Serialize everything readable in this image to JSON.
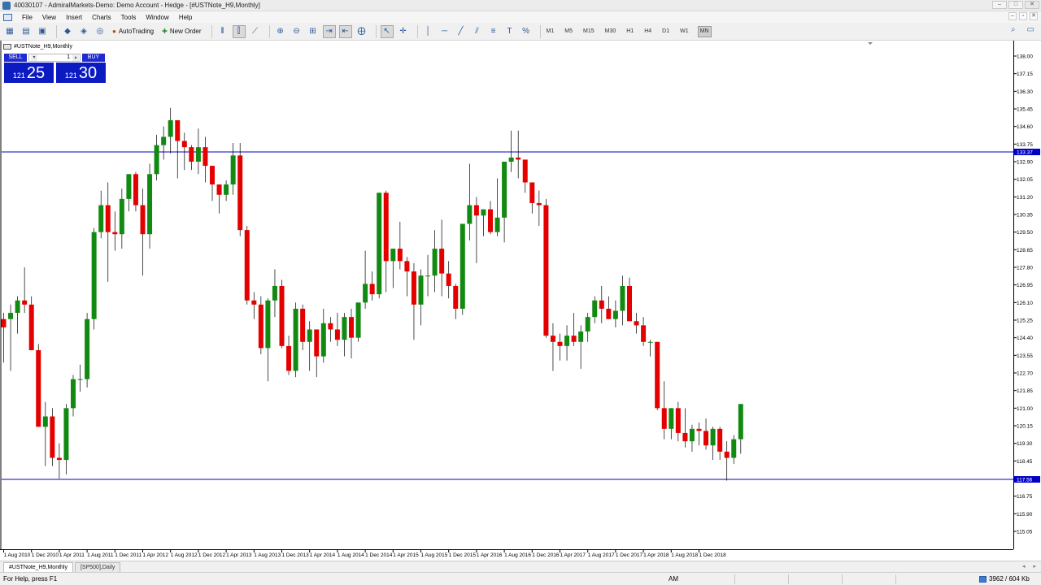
{
  "window": {
    "title": "40030107 - AdmiralMarkets-Demo: Demo Account - Hedge - [#USTNote_H9,Monthly]"
  },
  "menu": [
    "File",
    "View",
    "Insert",
    "Charts",
    "Tools",
    "Window",
    "Help"
  ],
  "toolbar": {
    "autotrading": "AutoTrading",
    "new_order": "New Order",
    "timeframes": [
      "M1",
      "M5",
      "M15",
      "M30",
      "H1",
      "H4",
      "D1",
      "W1",
      "MN"
    ],
    "active_timeframe": "MN"
  },
  "chart": {
    "label": "#USTNote_H9,Monthly",
    "trade_panel": {
      "sell_label": "SELL",
      "buy_label": "BUY",
      "lot": "1",
      "sell_price_small": "121",
      "sell_price_big": "25",
      "buy_price_small": "121",
      "buy_price_big": "30"
    },
    "colors": {
      "bull": "#128a12",
      "bear": "#e50000",
      "hline": "#0000c8",
      "price_tag": "#0000c8"
    }
  },
  "chart_data": {
    "type": "candlestick",
    "y_ticks": [
      "138.00",
      "137.15",
      "136.30",
      "135.45",
      "134.60",
      "133.75",
      "132.90",
      "132.05",
      "131.20",
      "130.35",
      "129.50",
      "128.65",
      "127.80",
      "126.95",
      "126.10",
      "125.25",
      "124.40",
      "123.55",
      "122.70",
      "121.85",
      "121.00",
      "120.15",
      "119.30",
      "118.45",
      "117.60",
      "116.75",
      "115.90",
      "115.05"
    ],
    "x_ticks": [
      "1 Aug 2010",
      "1 Dec 2010",
      "1 Apr 2011",
      "1 Aug 2011",
      "1 Dec 2011",
      "1 Apr 2012",
      "1 Aug 2012",
      "1 Dec 2012",
      "1 Apr 2013",
      "1 Aug 2013",
      "1 Dec 2013",
      "1 Apr 2014",
      "1 Aug 2014",
      "1 Dec 2014",
      "1 Apr 2015",
      "1 Aug 2015",
      "1 Dec 2015",
      "1 Apr 2016",
      "1 Aug 2016",
      "1 Dec 2016",
      "1 Apr 2017",
      "1 Aug 2017",
      "1 Dec 2017",
      "1 Apr 2018",
      "1 Aug 2018",
      "1 Dec 2018"
    ],
    "hlines": [
      {
        "price": 133.37,
        "label": "133.37"
      },
      {
        "price": 117.56,
        "label": "117.56"
      }
    ],
    "ohlc": [
      [
        125.3,
        125.6,
        123.2,
        124.9
      ],
      [
        125.3,
        126.0,
        122.8,
        125.6
      ],
      [
        125.6,
        126.4,
        124.6,
        126.2
      ],
      [
        126.2,
        127.8,
        125.6,
        126.0
      ],
      [
        126.0,
        126.4,
        123.8,
        123.8
      ],
      [
        123.8,
        124.1,
        120.2,
        120.1
      ],
      [
        120.1,
        121.3,
        118.2,
        120.6
      ],
      [
        120.6,
        121.0,
        118.2,
        118.6
      ],
      [
        118.6,
        119.3,
        117.6,
        118.5
      ],
      [
        118.5,
        121.2,
        117.8,
        121.0
      ],
      [
        121.0,
        122.6,
        120.6,
        122.4
      ],
      [
        122.4,
        123.1,
        121.8,
        122.4
      ],
      [
        122.4,
        125.6,
        122.0,
        125.3
      ],
      [
        125.3,
        129.7,
        124.8,
        129.5
      ],
      [
        129.5,
        131.5,
        129.2,
        130.8
      ],
      [
        130.8,
        131.9,
        127.1,
        129.5
      ],
      [
        129.5,
        130.5,
        128.6,
        129.4
      ],
      [
        129.4,
        131.6,
        128.7,
        131.1
      ],
      [
        131.1,
        132.3,
        130.5,
        132.3
      ],
      [
        132.3,
        132.4,
        130.5,
        130.8
      ],
      [
        130.8,
        131.6,
        127.4,
        129.4
      ],
      [
        129.4,
        132.8,
        128.7,
        132.3
      ],
      [
        132.3,
        134.2,
        132.0,
        133.7
      ],
      [
        133.7,
        134.6,
        133.0,
        134.1
      ],
      [
        134.1,
        135.5,
        133.3,
        134.9
      ],
      [
        134.9,
        134.6,
        132.1,
        133.9
      ],
      [
        133.9,
        134.3,
        132.5,
        133.6
      ],
      [
        133.6,
        133.7,
        132.5,
        132.9
      ],
      [
        132.9,
        134.5,
        132.3,
        133.6
      ],
      [
        133.6,
        134.1,
        131.9,
        132.7
      ],
      [
        132.7,
        132.6,
        131.0,
        131.8
      ],
      [
        131.8,
        131.3,
        130.4,
        131.3
      ],
      [
        131.3,
        132.0,
        131.0,
        131.8
      ],
      [
        131.8,
        133.8,
        131.3,
        133.2
      ],
      [
        133.2,
        133.8,
        129.3,
        129.6
      ],
      [
        129.6,
        129.8,
        126.0,
        126.2
      ],
      [
        126.2,
        126.6,
        125.3,
        126.0
      ],
      [
        126.0,
        126.4,
        123.6,
        123.9
      ],
      [
        123.9,
        126.3,
        122.3,
        126.2
      ],
      [
        126.2,
        127.7,
        125.4,
        126.9
      ],
      [
        126.9,
        127.2,
        123.9,
        124.0
      ],
      [
        124.0,
        124.5,
        122.6,
        122.8
      ],
      [
        122.8,
        126.1,
        122.5,
        125.8
      ],
      [
        125.8,
        126.0,
        123.8,
        124.2
      ],
      [
        124.2,
        125.2,
        122.8,
        124.8
      ],
      [
        124.8,
        124.4,
        122.5,
        123.5
      ],
      [
        123.5,
        125.8,
        123.2,
        125.1
      ],
      [
        125.1,
        125.4,
        124.2,
        124.8
      ],
      [
        124.8,
        125.6,
        124.0,
        124.3
      ],
      [
        124.3,
        125.6,
        123.5,
        125.4
      ],
      [
        125.4,
        125.8,
        123.4,
        124.4
      ],
      [
        124.4,
        126.0,
        124.2,
        126.1
      ],
      [
        126.1,
        128.6,
        125.8,
        127.0
      ],
      [
        127.0,
        127.6,
        126.2,
        126.5
      ],
      [
        126.5,
        130.0,
        126.3,
        131.4
      ],
      [
        131.4,
        131.5,
        126.6,
        128.1
      ],
      [
        128.1,
        128.6,
        126.8,
        128.7
      ],
      [
        128.7,
        130.0,
        127.7,
        128.1
      ],
      [
        128.1,
        128.3,
        126.4,
        127.6
      ],
      [
        127.6,
        128.0,
        124.3,
        126.0
      ],
      [
        126.0,
        127.7,
        125.0,
        127.4
      ],
      [
        127.4,
        128.4,
        126.4,
        127.4
      ],
      [
        127.4,
        129.6,
        126.6,
        128.7
      ],
      [
        128.7,
        130.1,
        126.4,
        127.5
      ],
      [
        127.5,
        128.1,
        126.3,
        126.9
      ],
      [
        126.9,
        127.0,
        125.3,
        125.8
      ],
      [
        125.8,
        129.8,
        125.5,
        129.9
      ],
      [
        129.9,
        132.8,
        129.1,
        130.8
      ],
      [
        130.8,
        131.2,
        128.0,
        130.3
      ],
      [
        130.3,
        130.6,
        129.3,
        130.6
      ],
      [
        130.6,
        131.0,
        129.4,
        129.5
      ],
      [
        129.5,
        132.1,
        129.3,
        130.2
      ],
      [
        130.2,
        132.6,
        129.0,
        132.9
      ],
      [
        132.9,
        134.4,
        132.4,
        133.1
      ],
      [
        133.1,
        134.4,
        132.1,
        133.0
      ],
      [
        133.0,
        132.6,
        131.4,
        131.9
      ],
      [
        131.9,
        131.6,
        130.4,
        130.9
      ],
      [
        130.9,
        131.5,
        129.8,
        130.8
      ],
      [
        130.8,
        131.1,
        124.4,
        124.5
      ],
      [
        124.5,
        125.1,
        122.8,
        124.2
      ],
      [
        124.2,
        124.6,
        123.3,
        124.0
      ],
      [
        124.0,
        125.0,
        123.3,
        124.5
      ],
      [
        124.5,
        125.6,
        124.0,
        124.2
      ],
      [
        124.2,
        125.0,
        122.9,
        124.7
      ],
      [
        124.7,
        125.6,
        124.2,
        125.4
      ],
      [
        125.4,
        126.4,
        125.1,
        126.2
      ],
      [
        126.2,
        126.9,
        125.1,
        125.8
      ],
      [
        125.8,
        126.4,
        125.3,
        125.3
      ],
      [
        125.3,
        126.2,
        124.9,
        125.7
      ],
      [
        125.7,
        127.4,
        125.0,
        126.9
      ],
      [
        126.9,
        127.3,
        125.2,
        125.2
      ],
      [
        125.2,
        125.6,
        124.6,
        125.0
      ],
      [
        125.0,
        125.4,
        124.0,
        124.2
      ],
      [
        124.2,
        124.3,
        123.5,
        124.2
      ],
      [
        124.2,
        124.2,
        120.9,
        121.0
      ],
      [
        121.0,
        122.3,
        119.5,
        120.0
      ],
      [
        120.0,
        121.0,
        119.5,
        121.0
      ],
      [
        121.0,
        121.3,
        119.4,
        119.8
      ],
      [
        119.8,
        121.0,
        119.1,
        119.4
      ],
      [
        119.4,
        120.2,
        118.9,
        120.0
      ],
      [
        120.0,
        120.3,
        119.2,
        119.9
      ],
      [
        119.9,
        120.5,
        119.0,
        119.2
      ],
      [
        119.2,
        120.1,
        118.5,
        120.0
      ],
      [
        120.0,
        120.1,
        118.5,
        118.9
      ],
      [
        118.9,
        119.4,
        117.5,
        118.6
      ],
      [
        118.6,
        119.7,
        118.3,
        119.5
      ],
      [
        119.5,
        121.2,
        118.8,
        121.2
      ]
    ]
  },
  "tabs": [
    "#USTNote_H9,Monthly",
    "[SP500],Daily"
  ],
  "status": {
    "help": "For Help, press F1",
    "ampm": "AM",
    "traffic": "3962 / 604 Kb"
  }
}
